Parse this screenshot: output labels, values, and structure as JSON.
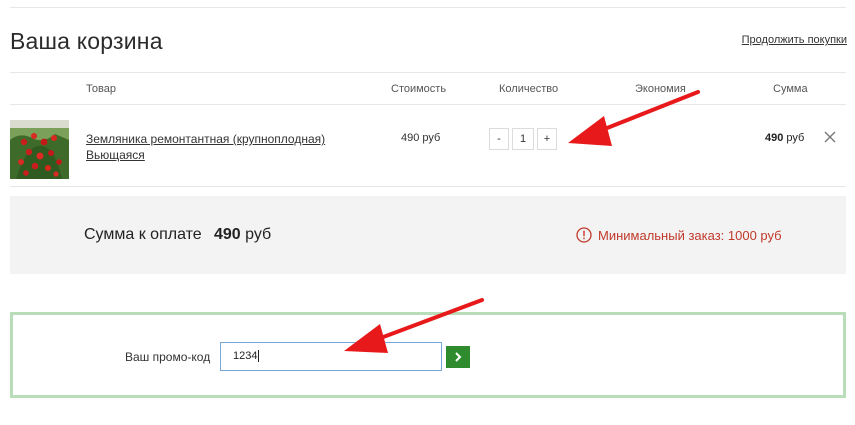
{
  "page_title": "Ваша корзина",
  "continue_link": "Продолжить покупки",
  "columns": {
    "product": "Товар",
    "price": "Стоимость",
    "quantity": "Количество",
    "savings": "Экономия",
    "total": "Сумма"
  },
  "items": [
    {
      "name": "Земляника ремонтантная (крупноплодная) Вьющаяся",
      "price": "490 руб",
      "quantity": "1",
      "decrement": "-",
      "increment": "+",
      "savings": "",
      "total_amount": "490",
      "total_currency": "руб"
    }
  ],
  "summary": {
    "label": "Сумма к оплате",
    "amount": "490",
    "currency": "руб",
    "min_order_warning": "Минимальный заказ: 1000 руб",
    "warning_color": "#c0392b"
  },
  "promo": {
    "label": "Ваш промо-код",
    "value": "1234",
    "submit_icon": "chevron-right-icon",
    "button_color": "#2e8b2e",
    "border_color": "#b9dcb9"
  },
  "annotation_color": "#e8191b"
}
